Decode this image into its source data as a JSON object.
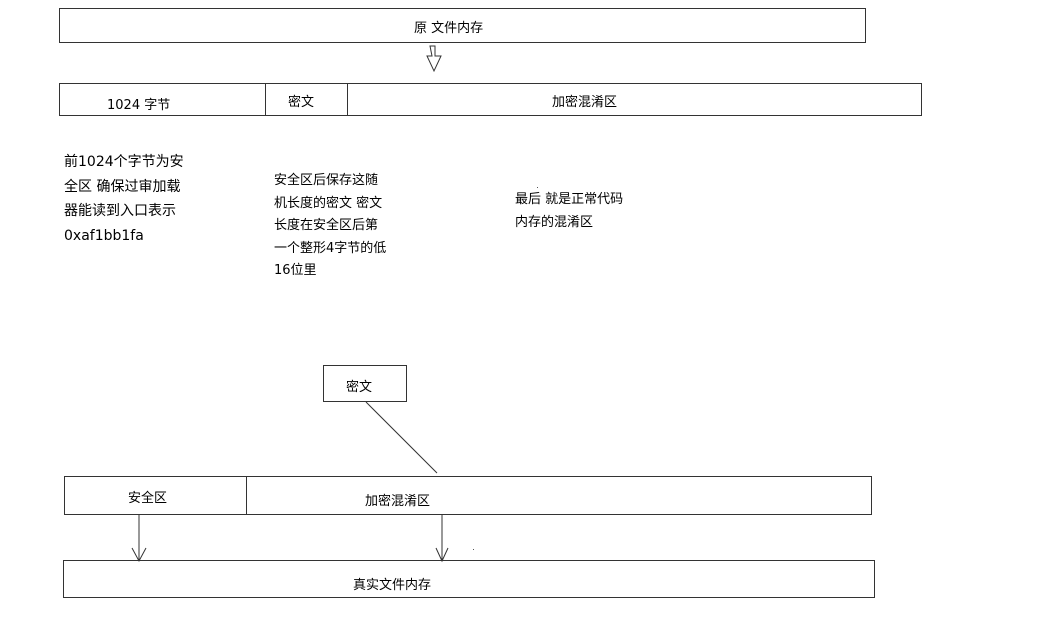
{
  "top_box": {
    "label": "原 文件内存"
  },
  "layout_row": {
    "safe": "1024 字节",
    "cipher": "密文",
    "obfuscated": "加密混淆区"
  },
  "notes": {
    "safe": "前1024个字节为安\n全区 确保过审加载\n器能读到入口表示\n0xaf1bb1fa",
    "cipher": "安全区后保存这随\n机长度的密文 密文\n长度在安全区后第\n一个整形4字节的低\n16位里",
    "obfuscated": "最后 就是正常代码\n内存的混淆区"
  },
  "cipher_box": {
    "label": "密文"
  },
  "bottom_row": {
    "safe": "安全区",
    "obfuscated": "加密混淆区"
  },
  "real_box": {
    "label": "真实文件内存"
  }
}
